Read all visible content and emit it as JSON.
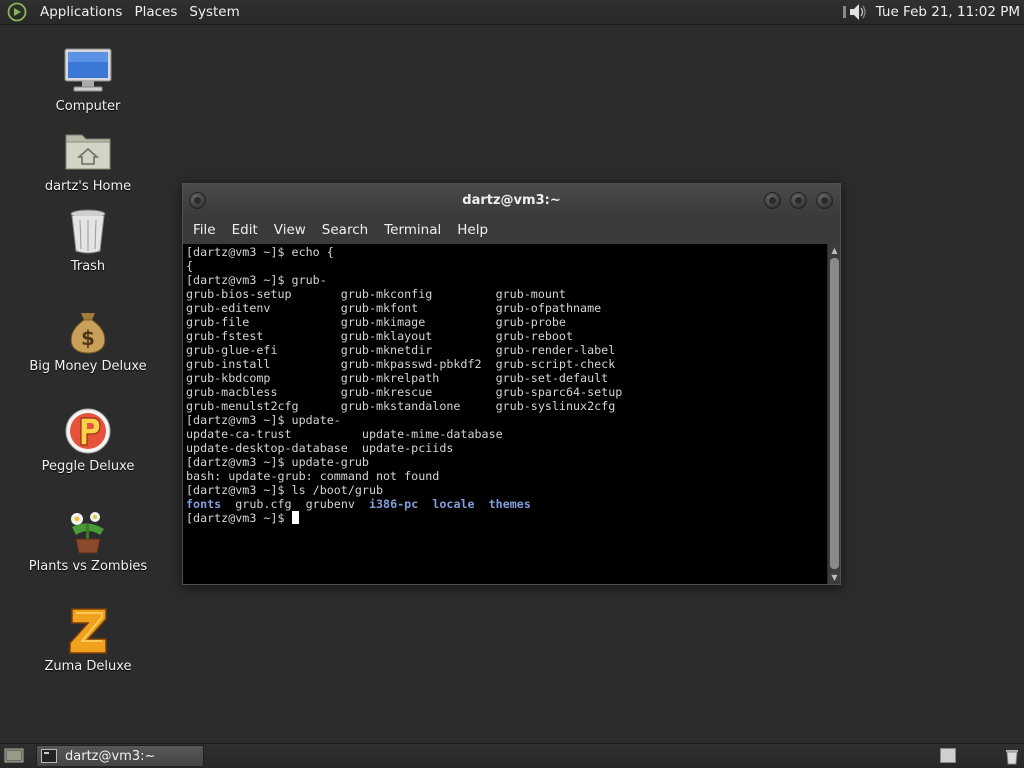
{
  "top_panel": {
    "menus": [
      "Applications",
      "Places",
      "System"
    ],
    "clock": "Tue Feb 21, 11:02 PM"
  },
  "desktop": {
    "icons": [
      {
        "label": "Computer",
        "icon": "computer-icon"
      },
      {
        "label": "dartz's Home",
        "icon": "home-folder-icon"
      },
      {
        "label": "Trash",
        "icon": "trash-icon"
      },
      {
        "label": "Big Money Deluxe",
        "icon": "money-bag-icon"
      },
      {
        "label": "Peggle Deluxe",
        "icon": "peggle-icon"
      },
      {
        "label": "Plants vs Zombies",
        "icon": "plants-vs-zombies-icon"
      },
      {
        "label": "Zuma Deluxe",
        "icon": "zuma-icon"
      }
    ]
  },
  "terminal": {
    "title": "dartz@vm3:~",
    "menu": [
      "File",
      "Edit",
      "View",
      "Search",
      "Terminal",
      "Help"
    ],
    "lines": [
      "[dartz@vm3 ~]$ echo {",
      "{",
      "[dartz@vm3 ~]$ grub-",
      "grub-bios-setup       grub-mkconfig         grub-mount",
      "grub-editenv          grub-mkfont           grub-ofpathname",
      "grub-file             grub-mkimage          grub-probe",
      "grub-fstest           grub-mklayout         grub-reboot",
      "grub-glue-efi         grub-mknetdir         grub-render-label",
      "grub-install          grub-mkpasswd-pbkdf2  grub-script-check",
      "grub-kbdcomp          grub-mkrelpath        grub-set-default",
      "grub-macbless         grub-mkrescue         grub-sparc64-setup",
      "grub-menulst2cfg      grub-mkstandalone     grub-syslinux2cfg",
      "[dartz@vm3 ~]$ update-",
      "update-ca-trust          update-mime-database",
      "update-desktop-database  update-pciids",
      "[dartz@vm3 ~]$ update-grub",
      "bash: update-grub: command not found",
      "[dartz@vm3 ~]$ ls /boot/grub"
    ],
    "ls_output": [
      "fonts",
      "grub.cfg",
      "grubenv",
      "i386-pc",
      "locale",
      "themes"
    ],
    "ls_dirs": [
      true,
      false,
      false,
      true,
      true,
      true
    ],
    "prompt": "[dartz@vm3 ~]$ "
  },
  "bottom_panel": {
    "task_label": "dartz@vm3:~"
  },
  "colors": {
    "desktop_bg": "#2b2c2b",
    "terminal_bg": "#000000",
    "terminal_fg": "#d4d4d4",
    "directory": "#7f9fdf"
  }
}
